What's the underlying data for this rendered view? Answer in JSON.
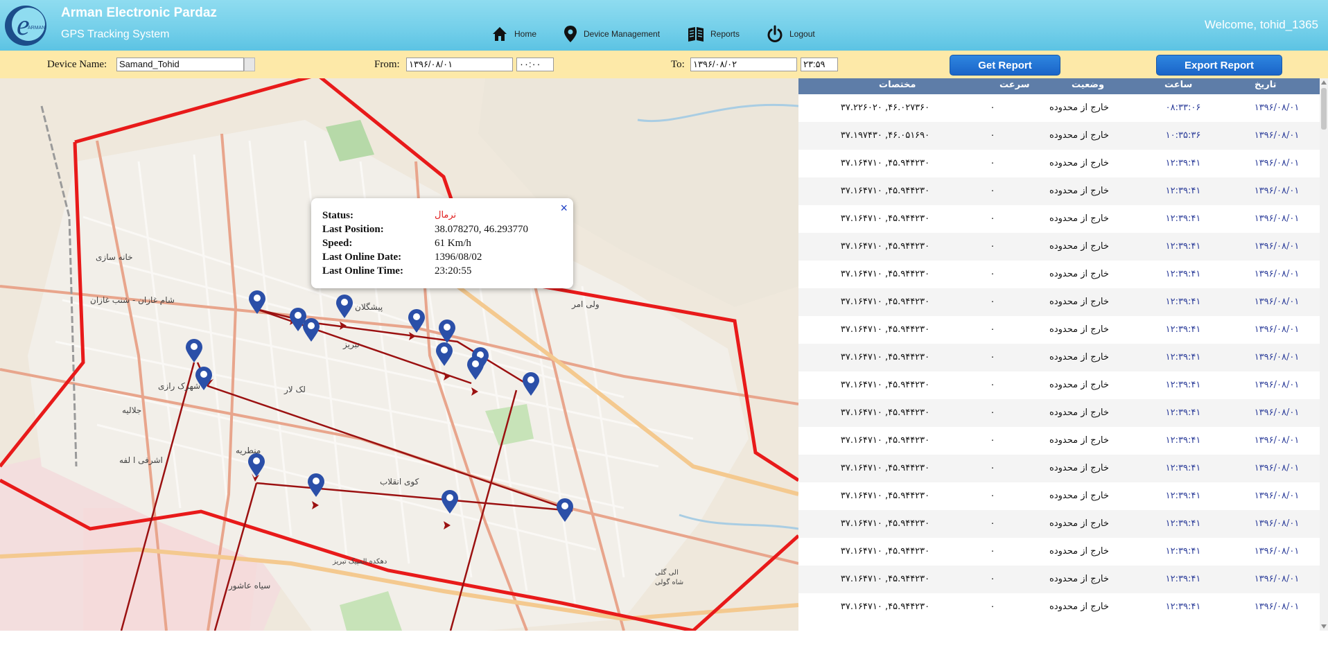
{
  "header": {
    "brand": "Arman Electronic Pardaz",
    "subtitle": "GPS Tracking System",
    "logo_text": "ARMAN",
    "welcome": "Welcome, tohid_1365",
    "nav": [
      {
        "label": "Home",
        "icon": "home-icon"
      },
      {
        "label": "Device Management",
        "icon": "location-pin-icon"
      },
      {
        "label": "Reports",
        "icon": "book-icon"
      },
      {
        "label": "Logout",
        "icon": "power-icon"
      }
    ]
  },
  "filters": {
    "device_label": "Device Name:",
    "device_value": "Samand_Tohid",
    "from_label": "From:",
    "from_date": "۱۳۹۶/۰۸/۰۱",
    "from_time": "۰۰:۰۰",
    "to_label": "To:",
    "to_date": "۱۳۹۶/۰۸/۰۲",
    "to_time": "۲۳:۵۹",
    "get_report": "Get Report",
    "export_report": "Export Report"
  },
  "popup": {
    "status_label": "Status:",
    "status_value": "نرمال",
    "position_label": "Last Position:",
    "position_value": "38.078270, 46.293770",
    "speed_label": "Speed:",
    "speed_value": "61 Km/h",
    "date_label": "Last Online Date:",
    "date_value": "1396/08/02",
    "time_label": "Last Online Time:",
    "time_value": "23:20:55",
    "close": "×"
  },
  "map_labels": [
    "خانه سازی",
    "شام غازان - شنب غازان",
    "ولی امر",
    "منطریه",
    "کوی انقلاب",
    "اشرفی ا لفه",
    "سیاه عاشور",
    "جلالیه",
    "لک لار",
    "تبریز",
    "شهرک رازی",
    "پیشگلان",
    "دهکده المپیک تبریز",
    "الی گلی",
    "شاه گولی"
  ],
  "table": {
    "headers": {
      "date": "تاریخ",
      "time": "ساعت",
      "status": "وضعیت",
      "speed": "سرعت",
      "coord": "مختصات"
    },
    "rows": [
      {
        "date": "۱۳۹۶/۰۸/۰۱",
        "time": "۰۸:۳۳:۰۶",
        "status": "خارج از محدوده",
        "speed": "۰",
        "coord": "۳۷.۲۲۶۰۲۰ ,۴۶.۰۲۷۳۶۰"
      },
      {
        "date": "۱۳۹۶/۰۸/۰۱",
        "time": "۱۰:۳۵:۳۶",
        "status": "خارج از محدوده",
        "speed": "۰",
        "coord": "۳۷.۱۹۷۴۳۰ ,۴۶.۰۵۱۶۹۰"
      },
      {
        "date": "۱۳۹۶/۰۸/۰۱",
        "time": "۱۲:۳۹:۴۱",
        "status": "خارج از محدوده",
        "speed": "۰",
        "coord": "۳۷.۱۶۴۷۱۰ ,۴۵.۹۴۴۲۳۰"
      },
      {
        "date": "۱۳۹۶/۰۸/۰۱",
        "time": "۱۲:۳۹:۴۱",
        "status": "خارج از محدوده",
        "speed": "۰",
        "coord": "۳۷.۱۶۴۷۱۰ ,۴۵.۹۴۴۲۳۰"
      },
      {
        "date": "۱۳۹۶/۰۸/۰۱",
        "time": "۱۲:۳۹:۴۱",
        "status": "خارج از محدوده",
        "speed": "۰",
        "coord": "۳۷.۱۶۴۷۱۰ ,۴۵.۹۴۴۲۳۰"
      },
      {
        "date": "۱۳۹۶/۰۸/۰۱",
        "time": "۱۲:۳۹:۴۱",
        "status": "خارج از محدوده",
        "speed": "۰",
        "coord": "۳۷.۱۶۴۷۱۰ ,۴۵.۹۴۴۲۳۰"
      },
      {
        "date": "۱۳۹۶/۰۸/۰۱",
        "time": "۱۲:۳۹:۴۱",
        "status": "خارج از محدوده",
        "speed": "۰",
        "coord": "۳۷.۱۶۴۷۱۰ ,۴۵.۹۴۴۲۳۰"
      },
      {
        "date": "۱۳۹۶/۰۸/۰۱",
        "time": "۱۲:۳۹:۴۱",
        "status": "خارج از محدوده",
        "speed": "۰",
        "coord": "۳۷.۱۶۴۷۱۰ ,۴۵.۹۴۴۲۳۰"
      },
      {
        "date": "۱۳۹۶/۰۸/۰۱",
        "time": "۱۲:۳۹:۴۱",
        "status": "خارج از محدوده",
        "speed": "۰",
        "coord": "۳۷.۱۶۴۷۱۰ ,۴۵.۹۴۴۲۳۰"
      },
      {
        "date": "۱۳۹۶/۰۸/۰۱",
        "time": "۱۲:۳۹:۴۱",
        "status": "خارج از محدوده",
        "speed": "۰",
        "coord": "۳۷.۱۶۴۷۱۰ ,۴۵.۹۴۴۲۳۰"
      },
      {
        "date": "۱۳۹۶/۰۸/۰۱",
        "time": "۱۲:۳۹:۴۱",
        "status": "خارج از محدوده",
        "speed": "۰",
        "coord": "۳۷.۱۶۴۷۱۰ ,۴۵.۹۴۴۲۳۰"
      },
      {
        "date": "۱۳۹۶/۰۸/۰۱",
        "time": "۱۲:۳۹:۴۱",
        "status": "خارج از محدوده",
        "speed": "۰",
        "coord": "۳۷.۱۶۴۷۱۰ ,۴۵.۹۴۴۲۳۰"
      },
      {
        "date": "۱۳۹۶/۰۸/۰۱",
        "time": "۱۲:۳۹:۴۱",
        "status": "خارج از محدوده",
        "speed": "۰",
        "coord": "۳۷.۱۶۴۷۱۰ ,۴۵.۹۴۴۲۳۰"
      },
      {
        "date": "۱۳۹۶/۰۸/۰۱",
        "time": "۱۲:۳۹:۴۱",
        "status": "خارج از محدوده",
        "speed": "۰",
        "coord": "۳۷.۱۶۴۷۱۰ ,۴۵.۹۴۴۲۳۰"
      },
      {
        "date": "۱۳۹۶/۰۸/۰۱",
        "time": "۱۲:۳۹:۴۱",
        "status": "خارج از محدوده",
        "speed": "۰",
        "coord": "۳۷.۱۶۴۷۱۰ ,۴۵.۹۴۴۲۳۰"
      },
      {
        "date": "۱۳۹۶/۰۸/۰۱",
        "time": "۱۲:۳۹:۴۱",
        "status": "خارج از محدوده",
        "speed": "۰",
        "coord": "۳۷.۱۶۴۷۱۰ ,۴۵.۹۴۴۲۳۰"
      },
      {
        "date": "۱۳۹۶/۰۸/۰۱",
        "time": "۱۲:۳۹:۴۱",
        "status": "خارج از محدوده",
        "speed": "۰",
        "coord": "۳۷.۱۶۴۷۱۰ ,۴۵.۹۴۴۲۳۰"
      },
      {
        "date": "۱۳۹۶/۰۸/۰۱",
        "time": "۱۲:۳۹:۴۱",
        "status": "خارج از محدوده",
        "speed": "۰",
        "coord": "۳۷.۱۶۴۷۱۰ ,۴۵.۹۴۴۲۳۰"
      },
      {
        "date": "۱۳۹۶/۰۸/۰۱",
        "time": "۱۲:۳۹:۴۱",
        "status": "خارج از محدوده",
        "speed": "۰",
        "coord": "۳۷.۱۶۴۷۱۰ ,۴۵.۹۴۴۲۳۰"
      }
    ]
  },
  "colors": {
    "header": "#75d0ea",
    "filterbar": "#fde9a8",
    "button": "#1f6fd2",
    "table_header": "#5e7da8",
    "geofence": "#e81a1a",
    "route": "#9b1111",
    "marker": "#2b4fa8"
  }
}
